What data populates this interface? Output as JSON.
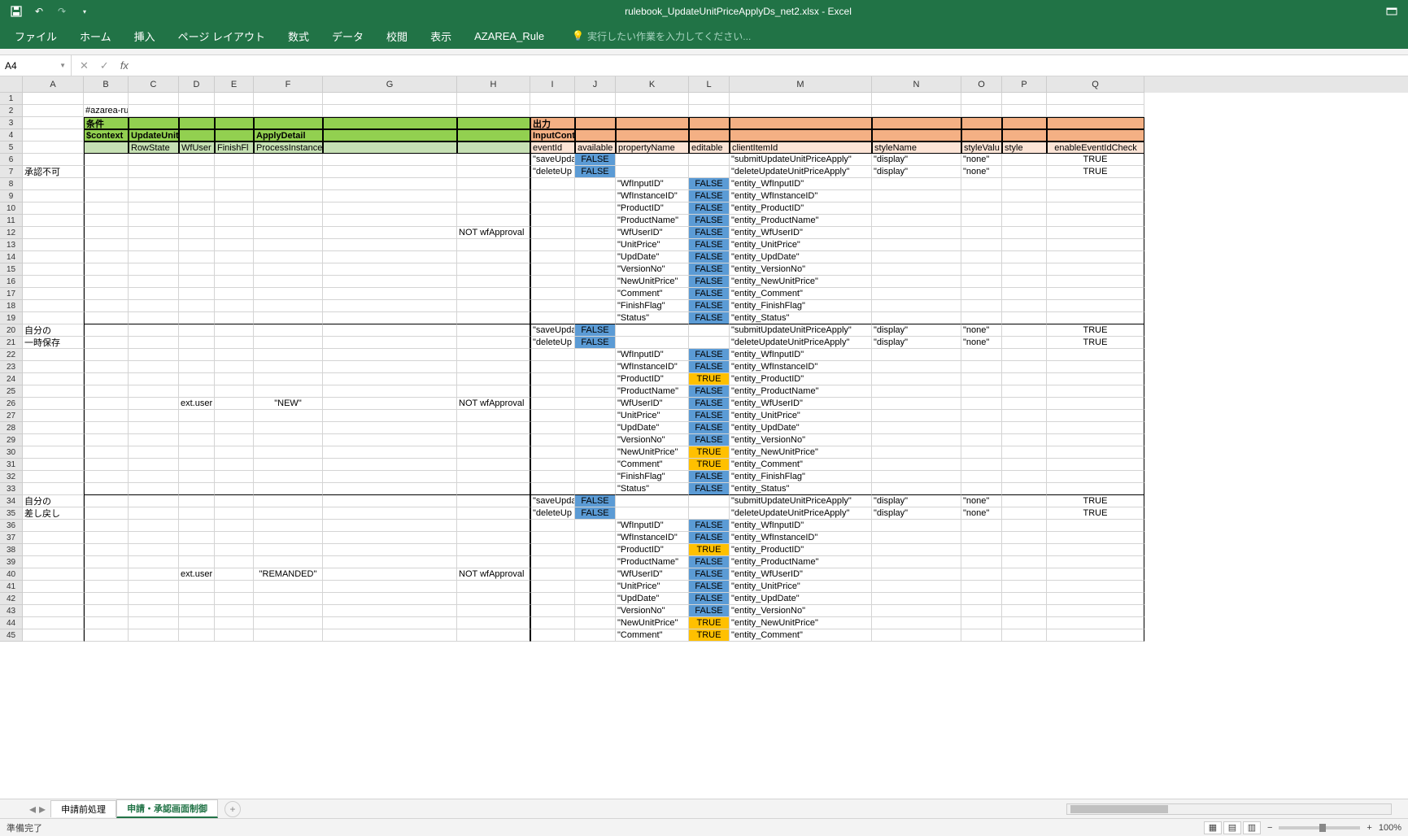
{
  "app": {
    "title": "rulebook_UpdateUnitPriceApplyDs_net2.xlsx - Excel"
  },
  "ribbon": {
    "tabs": [
      "ファイル",
      "ホーム",
      "挿入",
      "ページ レイアウト",
      "数式",
      "データ",
      "校閲",
      "表示",
      "AZAREA_Rule"
    ],
    "tellme": "実行したい作業を入力してください..."
  },
  "formula": {
    "namebox": "A4",
    "fx": "fx",
    "value": ""
  },
  "cols": [
    "A",
    "B",
    "C",
    "D",
    "E",
    "F",
    "G",
    "H",
    "I",
    "J",
    "K",
    "L",
    "M",
    "N",
    "O",
    "P",
    "Q"
  ],
  "rownums": [
    "1",
    "2",
    "3",
    "4",
    "5",
    "6",
    "7",
    "8",
    "9",
    "10",
    "11",
    "12",
    "13",
    "14",
    "15",
    "16",
    "17",
    "18",
    "19",
    "20",
    "21",
    "22",
    "23",
    "24",
    "25",
    "26",
    "27",
    "28",
    "29",
    "30",
    "31",
    "32",
    "33",
    "34",
    "35",
    "36",
    "37",
    "38",
    "39",
    "40",
    "41",
    "42",
    "43",
    "44",
    "45"
  ],
  "cells": {
    "r2": {
      "B": "#azarea-rule(editupdateunitprice-control)"
    },
    "r3": {
      "B": "条件",
      "I": "出力"
    },
    "r4": {
      "B": "$context",
      "C": "UpdateUnitPriceApply",
      "F": "ApplyDetail",
      "I": "InputControl"
    },
    "r5": {
      "C": "RowState",
      "D": "WfUser",
      "E": "FinishFl",
      "F": "ProcessInstance.Status",
      "I": "eventId",
      "J": "available",
      "K": "propertyName",
      "L": "editable",
      "M": "clientItemId",
      "N": "styleName",
      "O": "styleValu",
      "P": "style",
      "Q": "enableEventIdCheck"
    },
    "r6": {
      "I": "\"saveUpda",
      "J": "FALSE",
      "M": "\"submitUpdateUnitPriceApply\"",
      "N": "\"display\"",
      "O": "\"none\"",
      "Q": "TRUE"
    },
    "r7": {
      "A": "承認不可",
      "I": "\"deleteUp",
      "J": "FALSE",
      "M": "\"deleteUpdateUnitPriceApply\"",
      "N": "\"display\"",
      "O": "\"none\"",
      "Q": "TRUE"
    },
    "r8": {
      "K": "\"WfInputID\"",
      "L": "FALSE",
      "M": "\"entity_WfInputID\""
    },
    "r9": {
      "K": "\"WfInstanceID\"",
      "L": "FALSE",
      "M": "\"entity_WfInstanceID\""
    },
    "r10": {
      "K": "\"ProductID\"",
      "L": "FALSE",
      "M": "\"entity_ProductID\""
    },
    "r11": {
      "K": "\"ProductName\"",
      "L": "FALSE",
      "M": "\"entity_ProductName\""
    },
    "r12": {
      "H": "NOT wfApproval",
      "K": "\"WfUserID\"",
      "L": "FALSE",
      "M": "\"entity_WfUserID\""
    },
    "r13": {
      "K": "\"UnitPrice\"",
      "L": "FALSE",
      "M": "\"entity_UnitPrice\""
    },
    "r14": {
      "K": "\"UpdDate\"",
      "L": "FALSE",
      "M": "\"entity_UpdDate\""
    },
    "r15": {
      "K": "\"VersionNo\"",
      "L": "FALSE",
      "M": "\"entity_VersionNo\""
    },
    "r16": {
      "K": "\"NewUnitPrice\"",
      "L": "FALSE",
      "M": "\"entity_NewUnitPrice\""
    },
    "r17": {
      "K": "\"Comment\"",
      "L": "FALSE",
      "M": "\"entity_Comment\""
    },
    "r18": {
      "K": "\"FinishFlag\"",
      "L": "FALSE",
      "M": "\"entity_FinishFlag\""
    },
    "r19": {
      "K": "\"Status\"",
      "L": "FALSE",
      "M": "\"entity_Status\""
    },
    "r20": {
      "A": "自分の",
      "I": "\"saveUpda",
      "J": "FALSE",
      "M": "\"submitUpdateUnitPriceApply\"",
      "N": "\"display\"",
      "O": "\"none\"",
      "Q": "TRUE"
    },
    "r21": {
      "A": "一時保存",
      "I": "\"deleteUp",
      "J": "FALSE",
      "M": "\"deleteUpdateUnitPriceApply\"",
      "N": "\"display\"",
      "O": "\"none\"",
      "Q": "TRUE"
    },
    "r22": {
      "K": "\"WfInputID\"",
      "L": "FALSE",
      "M": "\"entity_WfInputID\""
    },
    "r23": {
      "K": "\"WfInstanceID\"",
      "L": "FALSE",
      "M": "\"entity_WfInstanceID\""
    },
    "r24": {
      "K": "\"ProductID\"",
      "L": "TRUE",
      "M": "\"entity_ProductID\""
    },
    "r25": {
      "K": "\"ProductName\"",
      "L": "FALSE",
      "M": "\"entity_ProductName\""
    },
    "r26": {
      "D": "ext.user",
      "F": "\"NEW\"",
      "H": "NOT wfApproval",
      "K": "\"WfUserID\"",
      "L": "FALSE",
      "M": "\"entity_WfUserID\""
    },
    "r27": {
      "K": "\"UnitPrice\"",
      "L": "FALSE",
      "M": "\"entity_UnitPrice\""
    },
    "r28": {
      "K": "\"UpdDate\"",
      "L": "FALSE",
      "M": "\"entity_UpdDate\""
    },
    "r29": {
      "K": "\"VersionNo\"",
      "L": "FALSE",
      "M": "\"entity_VersionNo\""
    },
    "r30": {
      "K": "\"NewUnitPrice\"",
      "L": "TRUE",
      "M": "\"entity_NewUnitPrice\""
    },
    "r31": {
      "K": "\"Comment\"",
      "L": "TRUE",
      "M": "\"entity_Comment\""
    },
    "r32": {
      "K": "\"FinishFlag\"",
      "L": "FALSE",
      "M": "\"entity_FinishFlag\""
    },
    "r33": {
      "K": "\"Status\"",
      "L": "FALSE",
      "M": "\"entity_Status\""
    },
    "r34": {
      "A": "自分の",
      "I": "\"saveUpda",
      "J": "FALSE",
      "M": "\"submitUpdateUnitPriceApply\"",
      "N": "\"display\"",
      "O": "\"none\"",
      "Q": "TRUE"
    },
    "r35": {
      "A": "差し戻し",
      "I": "\"deleteUp",
      "J": "FALSE",
      "M": "\"deleteUpdateUnitPriceApply\"",
      "N": "\"display\"",
      "O": "\"none\"",
      "Q": "TRUE"
    },
    "r36": {
      "K": "\"WfInputID\"",
      "L": "FALSE",
      "M": "\"entity_WfInputID\""
    },
    "r37": {
      "K": "\"WfInstanceID\"",
      "L": "FALSE",
      "M": "\"entity_WfInstanceID\""
    },
    "r38": {
      "K": "\"ProductID\"",
      "L": "TRUE",
      "M": "\"entity_ProductID\""
    },
    "r39": {
      "K": "\"ProductName\"",
      "L": "FALSE",
      "M": "\"entity_ProductName\""
    },
    "r40": {
      "D": "ext.user",
      "F": "\"REMANDED\"",
      "H": "NOT wfApproval",
      "K": "\"WfUserID\"",
      "L": "FALSE",
      "M": "\"entity_WfUserID\""
    },
    "r41": {
      "K": "\"UnitPrice\"",
      "L": "FALSE",
      "M": "\"entity_UnitPrice\""
    },
    "r42": {
      "K": "\"UpdDate\"",
      "L": "FALSE",
      "M": "\"entity_UpdDate\""
    },
    "r43": {
      "K": "\"VersionNo\"",
      "L": "FALSE",
      "M": "\"entity_VersionNo\""
    },
    "r44": {
      "K": "\"NewUnitPrice\"",
      "L": "TRUE",
      "M": "\"entity_NewUnitPrice\""
    },
    "r45": {
      "K": "\"Comment\"",
      "L": "TRUE",
      "M": "\"entity_Comment\""
    }
  },
  "sheets": {
    "tabs": [
      "申請前処理",
      "申請・承認画面制御"
    ],
    "active": 1
  },
  "status": {
    "ready": "準備完了",
    "zoom": "100%"
  }
}
